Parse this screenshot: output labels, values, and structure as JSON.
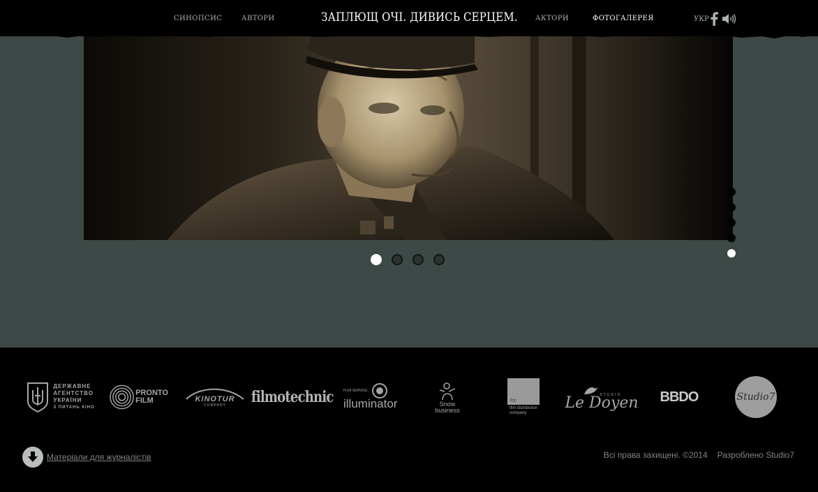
{
  "nav": {
    "left": [
      "СИНОПСИС",
      "АВТОРИ"
    ],
    "title": "ЗАПЛЮЩ ОЧІ. ДИВИСЬ СЕРЦЕМ.",
    "right": [
      "АКТОРИ",
      "ФОТОГАЛЕРЕЯ"
    ],
    "active": "ФОТОГАЛЕРЕЯ",
    "language": "УКР",
    "icons": [
      "facebook-icon",
      "sound-icon"
    ]
  },
  "gallery": {
    "pagination": [
      "1",
      "2",
      "3",
      "4"
    ],
    "active_page": 1,
    "side_dots_count": 5,
    "side_active": 5
  },
  "partners": [
    {
      "name": "ДЕРЖАВНЕ АГЕНТСТВО УКРАЇНИ З ПИТАНЬ КІНО",
      "lines": [
        "ДЕРЖАВНЕ",
        "АГЕНТСТВО",
        "УКРАЇНИ",
        "З ПИТАНЬ КІНО"
      ]
    },
    {
      "name": "PRONTO FILM",
      "lines": [
        "PRONTO",
        "FILM"
      ]
    },
    {
      "name": "KINOTUR COMPANY",
      "lines": [
        "KINOTUR",
        "COMPANY"
      ]
    },
    {
      "name": "filmotechnic",
      "lines": [
        "filmotechnic"
      ]
    },
    {
      "name": "illuminator",
      "lines": [
        "FILM SERVICE",
        "illuminator"
      ]
    },
    {
      "name": "Snow business",
      "lines": [
        "Snow",
        "business"
      ]
    },
    {
      "name": "film distribution company",
      "lines": [
        "fdc",
        "film distribution",
        "company"
      ]
    },
    {
      "name": "Le Doyen studio",
      "lines": [
        "STUDIO",
        "Le Doyen"
      ]
    },
    {
      "name": "BBDO",
      "lines": [
        "BBDO"
      ]
    },
    {
      "name": "Studio7",
      "lines": [
        "Studio7"
      ]
    }
  ],
  "footer": {
    "press_label": "Матеріали для журналістів",
    "rights": "Всі права захищені. ©2014",
    "developer": "Разроблено Studio7"
  }
}
